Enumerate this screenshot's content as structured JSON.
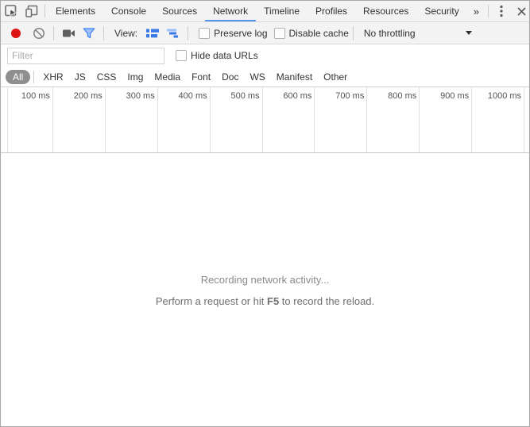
{
  "tabbar": {
    "tabs": [
      {
        "label": "Elements"
      },
      {
        "label": "Console"
      },
      {
        "label": "Sources"
      },
      {
        "label": "Network"
      },
      {
        "label": "Timeline"
      },
      {
        "label": "Profiles"
      },
      {
        "label": "Resources"
      },
      {
        "label": "Security"
      }
    ],
    "active_tab": "Network",
    "overflow_chevron": "»"
  },
  "toolbar": {
    "view_label": "View:",
    "preserve_log_label": "Preserve log",
    "preserve_log_checked": false,
    "disable_cache_label": "Disable cache",
    "disable_cache_checked": false,
    "throttling_value": "No throttling"
  },
  "filter_row": {
    "placeholder": "Filter",
    "value": "",
    "hide_data_urls_label": "Hide data URLs",
    "hide_data_urls_checked": false
  },
  "type_filters": {
    "selected": "All",
    "items": [
      {
        "label": "All"
      },
      {
        "label": "XHR"
      },
      {
        "label": "JS"
      },
      {
        "label": "CSS"
      },
      {
        "label": "Img"
      },
      {
        "label": "Media"
      },
      {
        "label": "Font"
      },
      {
        "label": "Doc"
      },
      {
        "label": "WS"
      },
      {
        "label": "Manifest"
      },
      {
        "label": "Other"
      }
    ]
  },
  "ruler": {
    "ticks": [
      "100 ms",
      "200 ms",
      "300 ms",
      "400 ms",
      "500 ms",
      "600 ms",
      "700 ms",
      "800 ms",
      "900 ms",
      "1000 ms"
    ]
  },
  "message": {
    "line1": "Recording network activity...",
    "line2_prefix": "Perform a request or hit ",
    "line2_key": "F5",
    "line2_suffix": " to record the reload."
  },
  "icons": {
    "inspect": "cursor-in-box",
    "device_toolbar": "phone-and-screen",
    "more": "vertical-ellipsis",
    "close": "x",
    "record": "red-circle",
    "clear": "circle-with-slash",
    "screenshot": "video-camera",
    "filter": "funnel",
    "large_rows": "list-rows",
    "overview": "waterfall-bars",
    "dropdown": "down-triangle"
  },
  "colors": {
    "accent_blue": "#4285f4",
    "tab_underline": "#5195ee",
    "record_red": "#dd1414",
    "toolbar_bg": "#f3f3f3",
    "border": "#d8d8d8",
    "pill_bg": "#8f8f8f",
    "muted_text": "#8a8a8a"
  }
}
